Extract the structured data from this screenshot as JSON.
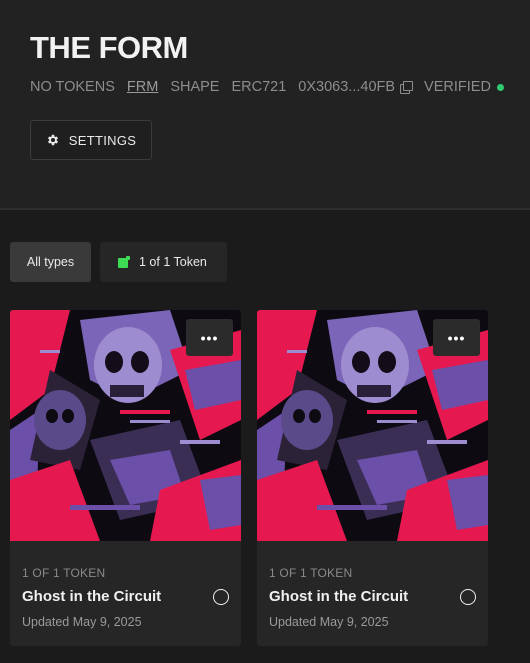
{
  "collection": {
    "title": "THE FORM",
    "meta": {
      "token_count": "NO TOKENS",
      "symbol": "FRM",
      "contract_name": "SHAPE",
      "standard": "ERC721",
      "address": "0X3063...40FB",
      "status": "VERIFIED",
      "status_color": "#2ecc71"
    },
    "settings_label": "SETTINGS"
  },
  "filters": {
    "all_label": "All types",
    "token_label": "1 of 1 Token",
    "token_icon_color": "#3ddc54"
  },
  "cards": [
    {
      "kind": "1 OF 1 TOKEN",
      "name": "Ghost in the Circuit",
      "updated": "Updated May 9, 2025",
      "menu_label": "•••"
    },
    {
      "kind": "1 OF 1 TOKEN",
      "name": "Ghost in the Circuit",
      "updated": "Updated May 9, 2025",
      "menu_label": "•••"
    }
  ],
  "icons": {
    "settings": "gear-icon",
    "copy": "copy-icon",
    "verified": "status-dot-icon",
    "token": "token-icon",
    "menu": "more-icon"
  }
}
